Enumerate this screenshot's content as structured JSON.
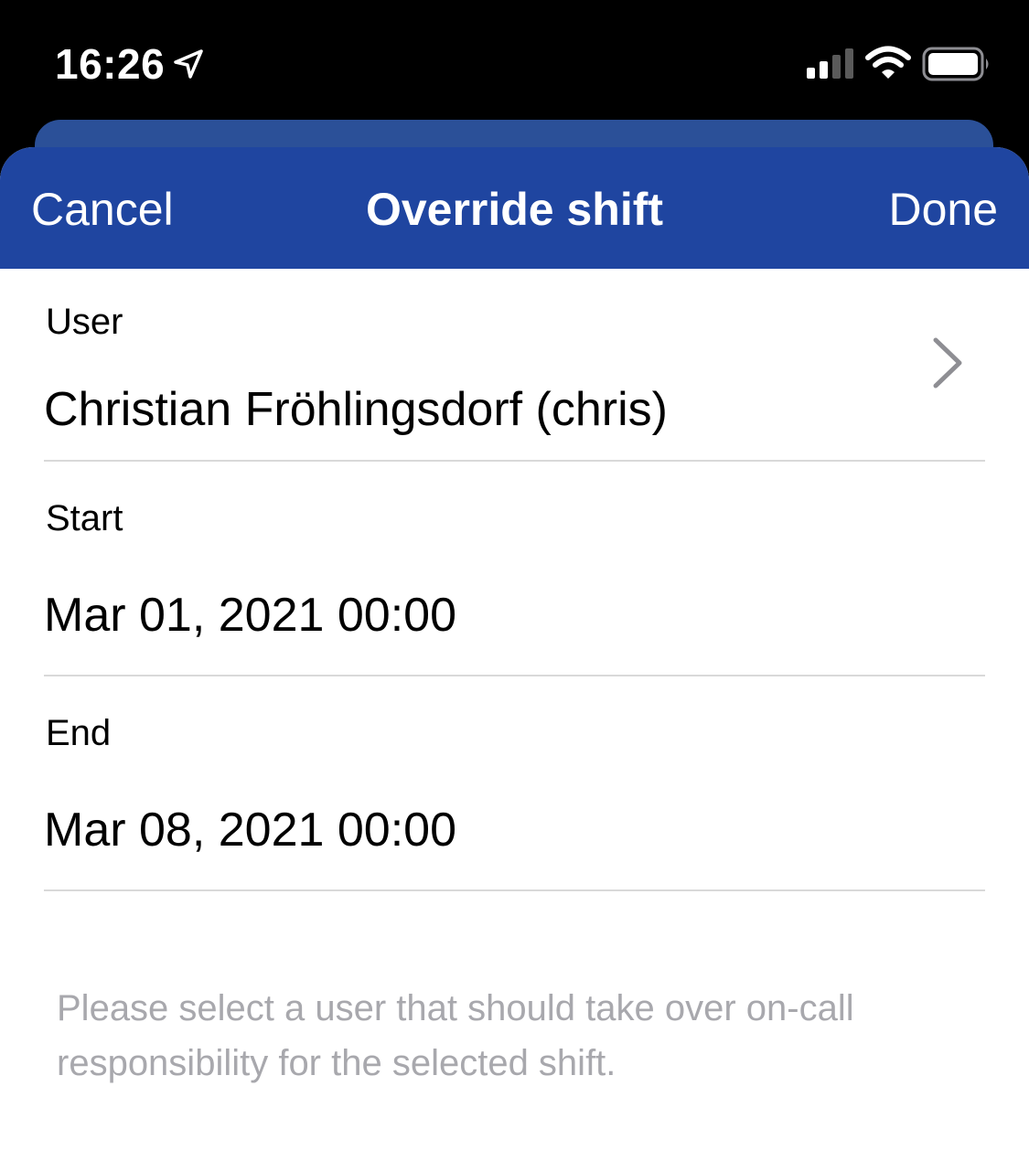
{
  "status_bar": {
    "time": "16:26"
  },
  "nav": {
    "cancel_label": "Cancel",
    "title": "Override shift",
    "done_label": "Done",
    "accent_color": "#1f45a0"
  },
  "form": {
    "user": {
      "label": "User",
      "value": "Christian Fröhlingsdorf (chris)"
    },
    "start": {
      "label": "Start",
      "value": "Mar 01, 2021 00:00"
    },
    "end": {
      "label": "End",
      "value": "Mar 08, 2021 00:00"
    }
  },
  "helper_text": "Please select a user that should take over on-call responsibility for the selected shift.",
  "icons": {
    "location": "location-arrow-icon",
    "signal": "cellular-signal-icon",
    "wifi": "wifi-icon",
    "battery": "battery-icon",
    "chevron": "chevron-right-icon"
  }
}
